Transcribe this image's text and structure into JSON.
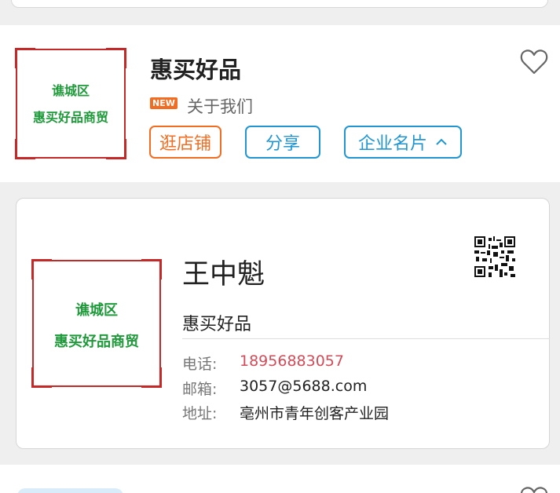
{
  "shop": {
    "logo_line1": "谯城区",
    "logo_line2": "惠买好品商贸",
    "title": "惠买好品",
    "badge": "NEW",
    "about": "关于我们",
    "buttons": {
      "visit": "逛店铺",
      "share": "分享",
      "card": "企业名片",
      "card_chevron": "^"
    }
  },
  "card": {
    "logo_line1": "谯城区",
    "logo_line2": "惠买好品商贸",
    "name": "王中魁",
    "company": "惠买好品",
    "phone_label": "电话:",
    "phone": "18956883057",
    "email_label": "邮箱:",
    "email": "3057@5688.com",
    "address_label": "地址:",
    "address": "亳州市青年创客产业园"
  },
  "colors": {
    "accent_orange": "#f26d21",
    "accent_blue": "#2196d3",
    "phone_red": "#d24b58",
    "logo_red": "#c62828",
    "logo_green": "#1f9a3a"
  },
  "icons": {
    "favorite": "heart-outline-icon",
    "qr": "qr-code-icon"
  }
}
